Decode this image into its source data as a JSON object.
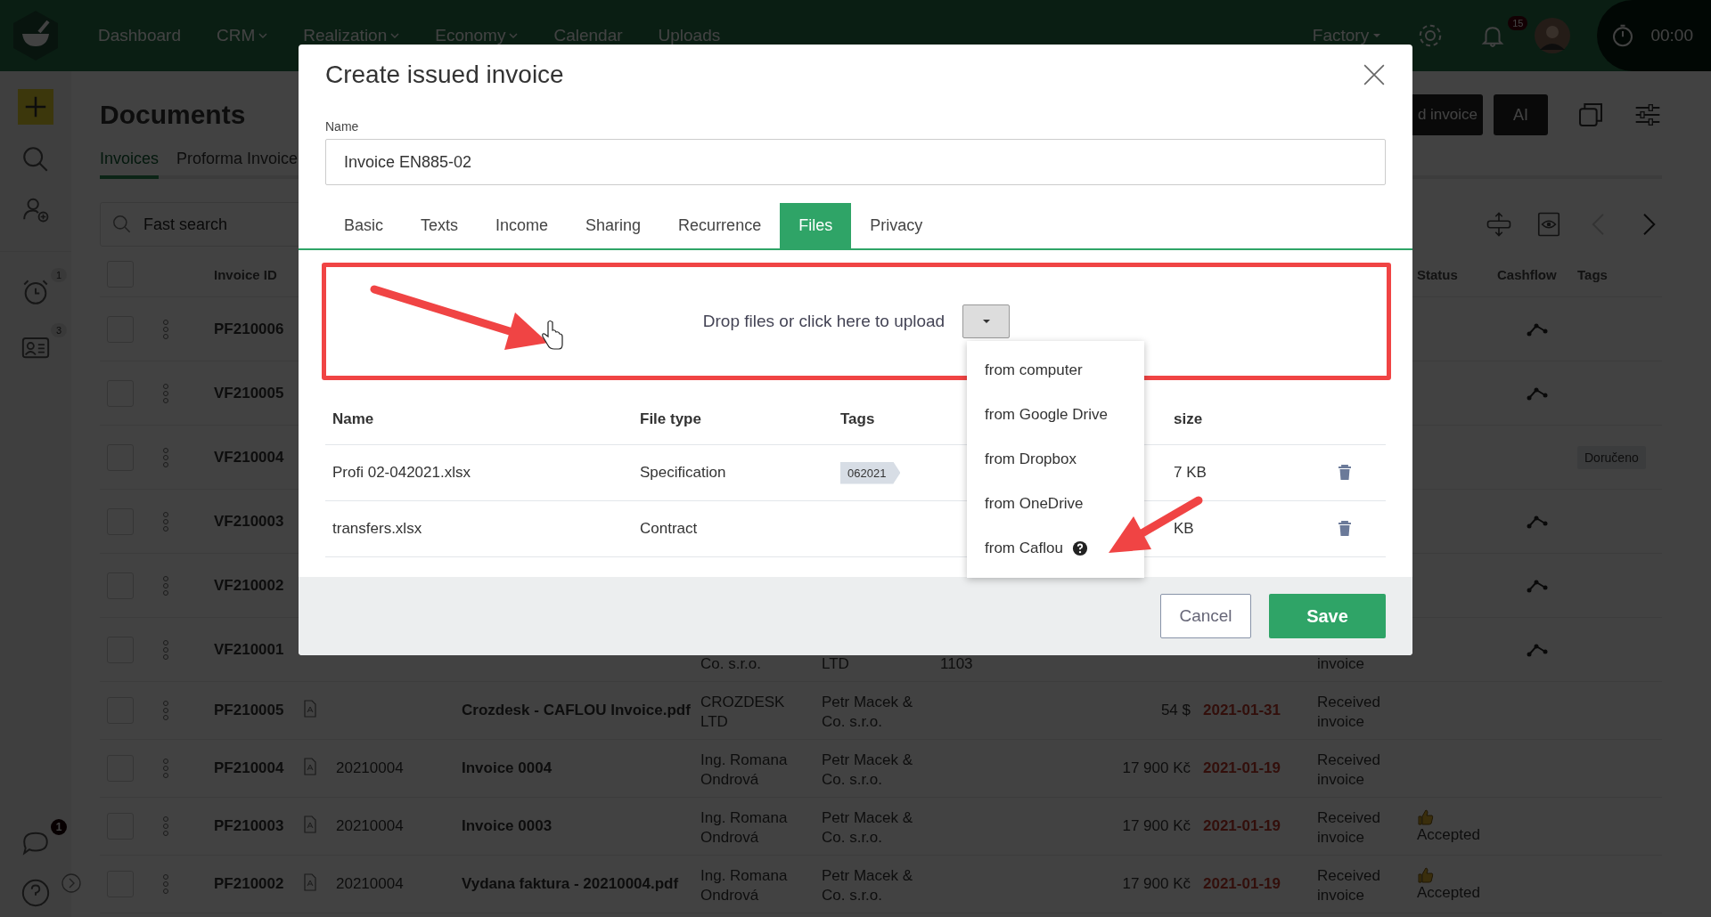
{
  "top_nav": {
    "items": [
      {
        "label": "Dashboard",
        "dropdown": false
      },
      {
        "label": "CRM",
        "dropdown": true
      },
      {
        "label": "Realization",
        "dropdown": true
      },
      {
        "label": "Economy",
        "dropdown": true
      },
      {
        "label": "Calendar",
        "dropdown": false
      },
      {
        "label": "Uploads",
        "dropdown": false
      }
    ],
    "workspace": "Factory",
    "notification_count": "15",
    "timer": "00:00"
  },
  "sidebar": {
    "reminder_count": "1",
    "contacts_count": "3",
    "chat_count": "1"
  },
  "page": {
    "title": "Documents",
    "buttons": [
      "d invoice",
      "AI"
    ],
    "tabs": [
      {
        "label": "Invoices",
        "selected": true
      },
      {
        "label": "Proforma Invoice",
        "selected": false
      }
    ],
    "search": {
      "placeholder": "Fast search"
    },
    "pager": {
      "previous_disabled": true,
      "next_disabled": false
    }
  },
  "table": {
    "select_all_checked": false,
    "columns": {
      "id": "Invoice ID",
      "status": "Status",
      "cashflow": "Cashflow",
      "tags": "Tags"
    },
    "rows": [
      {
        "checked": false,
        "id": "PF210006",
        "cashflow": true
      },
      {
        "checked": false,
        "id": "VF210005",
        "cashflow": true
      },
      {
        "checked": false,
        "id": "VF210004",
        "cashflow": false,
        "tag": "Doručeno"
      },
      {
        "checked": false,
        "id": "VF210003",
        "cashflow": true
      },
      {
        "checked": false,
        "id": "VF210002",
        "cashflow": true
      },
      {
        "checked": false,
        "id": "VF210001",
        "cashflow": true,
        "supplier": "Co. s.r.o.",
        "customer": "LTD",
        "column_9": "1103",
        "type": "invoice"
      },
      {
        "checked": false,
        "id": "PF210005",
        "cashflow": false,
        "has_file": true,
        "name": "Crozdesk - CAFLOU Invoice.pdf",
        "supplier": "CROZDESK LTD",
        "customer": "Petr Macek & Co. s.r.o.",
        "amount": "54 $",
        "date": "2021-01-31",
        "type": "Received invoice"
      },
      {
        "checked": false,
        "id": "PF210004",
        "cashflow": false,
        "has_file": true,
        "number": "20210004",
        "name": "Invoice 0004",
        "supplier": "Ing. Romana Ondrová",
        "customer": "Petr Macek & Co. s.r.o.",
        "amount": "17 900 Kč",
        "date": "2021-01-19",
        "type": "Received invoice"
      },
      {
        "checked": false,
        "id": "PF210003",
        "cashflow": false,
        "has_file": true,
        "number": "20210004",
        "name": "Invoice 0003",
        "supplier": "Ing. Romana Ondrová",
        "customer": "Petr Macek & Co. s.r.o.",
        "amount": "17 900 Kč",
        "date": "2021-01-19",
        "type": "Received invoice",
        "status": "Accepted"
      },
      {
        "checked": false,
        "id": "PF210002",
        "cashflow": false,
        "has_file": true,
        "number": "20210004",
        "name": "Vydana faktura - 20210004.pdf",
        "supplier": "Ing. Romana Ondrová",
        "customer": "Petr Macek & Co. s.r.o.",
        "amount": "17 900 Kč",
        "date": "2021-01-19",
        "type": "Received invoice",
        "status": "Accepted"
      }
    ]
  },
  "dialog": {
    "title": "Create issued invoice",
    "name_label": "Name",
    "name_value": "Invoice EN885-02",
    "tabs": [
      {
        "label": "Basic",
        "selected": false
      },
      {
        "label": "Texts",
        "selected": false
      },
      {
        "label": "Income",
        "selected": false
      },
      {
        "label": "Sharing",
        "selected": false
      },
      {
        "label": "Recurrence",
        "selected": false
      },
      {
        "label": "Files",
        "selected": true
      },
      {
        "label": "Privacy",
        "selected": false
      }
    ],
    "upload_text": "Drop files or click here to upload",
    "upload_menu": [
      {
        "label": "from computer",
        "help": false
      },
      {
        "label": "from Google Drive",
        "help": false
      },
      {
        "label": "from Dropbox",
        "help": false
      },
      {
        "label": "from OneDrive",
        "help": false
      },
      {
        "label": "from Caflou",
        "help": true
      }
    ],
    "files": {
      "columns": [
        "Name",
        "File type",
        "Tags",
        "size"
      ],
      "rows": [
        {
          "name": "Profi 02-042021.xlsx",
          "file_type": "Specification",
          "tag": "062021",
          "size": "7 KB"
        },
        {
          "name": "transfers.xlsx",
          "file_type": "Contract",
          "size": "KB"
        }
      ]
    },
    "buttons": {
      "cancel": "Cancel",
      "save": "Save"
    }
  }
}
